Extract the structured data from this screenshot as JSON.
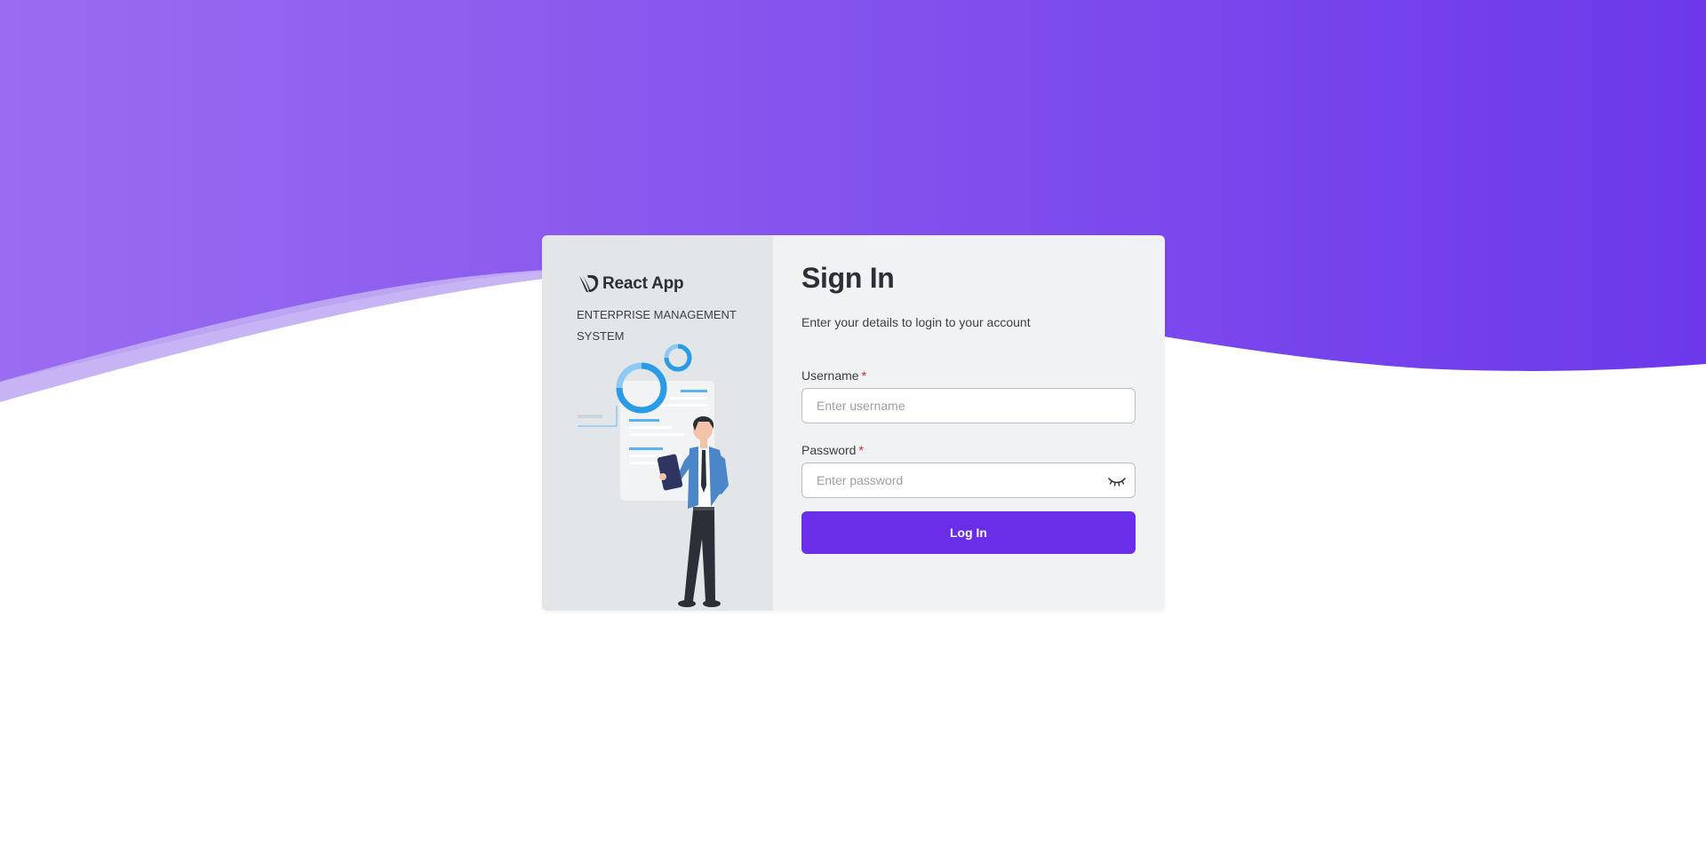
{
  "app": {
    "name": "React App",
    "tagline": "ENTERPRISE MANAGEMENT SYSTEM"
  },
  "form": {
    "title": "Sign In",
    "subtitle": "Enter your details to login to your account",
    "username": {
      "label": "Username",
      "required_marker": "*",
      "placeholder": "Enter username",
      "value": ""
    },
    "password": {
      "label": "Password",
      "required_marker": "*",
      "placeholder": "Enter password",
      "value": "",
      "toggle_icon": "eye-closed-icon"
    },
    "submit_label": "Log In"
  },
  "colors": {
    "accent": "#6a2ee8",
    "background_gradient_start": "#9a6cf0",
    "background_gradient_end": "#6c38ea",
    "wave_light": "#c6b4f5",
    "required": "#e02424"
  },
  "icons": {
    "brand": "react-app-logo-icon",
    "illustration": "businessman-with-tablet-illustration"
  }
}
